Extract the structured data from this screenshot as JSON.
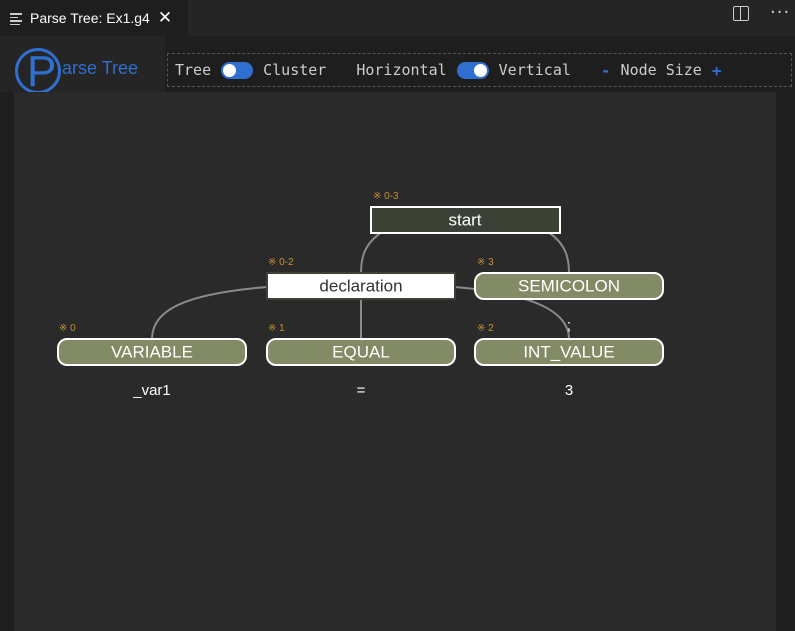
{
  "tab": {
    "title": "Parse Tree: Ex1.g4",
    "close": "✕"
  },
  "header": {
    "logo_letter": "P",
    "logo_text": "arse Tree",
    "toolbar": {
      "tree": "Tree",
      "cluster": "Cluster",
      "horizontal": "Horizontal",
      "vertical": "Vertical",
      "minus": "-",
      "node_size": "Node Size",
      "plus": "+"
    }
  },
  "colors": {
    "accent": "#2f6fcf",
    "rule_node_dark": "#3b4134",
    "rule_node_light": "#ffffff",
    "terminal_node": "#838b66",
    "index_text": "#c98f36"
  },
  "tree": {
    "start": {
      "label": "start",
      "index": "※ 0-3"
    },
    "declaration": {
      "label": "declaration",
      "index": "※ 0-2"
    },
    "semicolon": {
      "label": "SEMICOLON",
      "index": "※ 3",
      "token": ";"
    },
    "variable": {
      "label": "VARIABLE",
      "index": "※ 0",
      "token": "_var1"
    },
    "equal": {
      "label": "EQUAL",
      "index": "※ 1",
      "token": "="
    },
    "int_value": {
      "label": "INT_VALUE",
      "index": "※ 2",
      "token": "3"
    }
  }
}
